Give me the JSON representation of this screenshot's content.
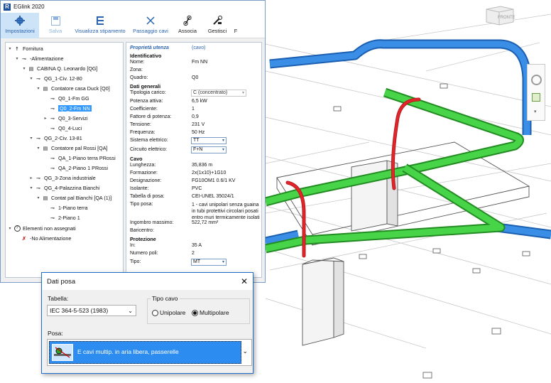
{
  "window": {
    "title": "EGlink 2020",
    "logo": "R"
  },
  "toolbar": [
    {
      "label": "Impostazioni",
      "icon": "gear-icon"
    },
    {
      "label": "Salva",
      "icon": "save-icon"
    },
    {
      "label": "Visualizza stipamento",
      "icon": "stipamento-icon"
    },
    {
      "label": "Passaggio cavi",
      "icon": "cross-icon"
    },
    {
      "label": "Associa",
      "icon": "link-icon"
    },
    {
      "label": "Gestisci",
      "icon": "tools-icon"
    },
    {
      "label": "F"
    }
  ],
  "tree": [
    {
      "label": "Fornitura"
    },
    {
      "label": "-Alimentazione"
    },
    {
      "label": "CABINA Q. Leonardo [QG]"
    },
    {
      "label": "QG_1-Civ. 12-80"
    },
    {
      "label": "Contatore casa Duck [Q0]"
    },
    {
      "label": "Q0_1-Fm GG"
    },
    {
      "label": "Q0_2-Fm NN"
    },
    {
      "label": "Q0_3-Servizi"
    },
    {
      "label": "Q0_4-Luci"
    },
    {
      "label": "QG_2-Civ. 13-81"
    },
    {
      "label": "Contatore pal Rossi [QA]"
    },
    {
      "label": "QA_1-Piano terra PRossi"
    },
    {
      "label": "QA_2-Piano 1  PRossi"
    },
    {
      "label": "QG_3-Zona industriale"
    },
    {
      "label": "QG_4-Palazzina Bianchi"
    },
    {
      "label": "Contat pal Bianchi [QA (1)]"
    },
    {
      "label": "1-Piano terra"
    },
    {
      "label": "2-Piano 1"
    },
    {
      "label": "Elementi non assegnati"
    },
    {
      "label": "-No Alimentazione"
    }
  ],
  "props": {
    "header": "Proprietà utenza",
    "header_type": "(cavo)",
    "sections": {
      "id": "Identificativo",
      "general": "Dati generali",
      "cable": "Cavo",
      "protection": "Protezione"
    },
    "rows": [
      {
        "k": "Nome:",
        "v": "Fm NN"
      },
      {
        "k": "Zona:",
        "v": ""
      },
      {
        "k": "Quadro:",
        "v": "Q0"
      },
      {
        "k": "Tipologia carico:",
        "v": "C (concentrato)"
      },
      {
        "k": "Potenza attiva:",
        "v": "6,5 kW"
      },
      {
        "k": "Coefficiente:",
        "v": "1"
      },
      {
        "k": "Fattore di potenza:",
        "v": "0,9"
      },
      {
        "k": "Tensione:",
        "v": "231 V"
      },
      {
        "k": "Frequenza:",
        "v": "50 Hz"
      },
      {
        "k": "Sistema elettrico:",
        "v": "TT"
      },
      {
        "k": "Circuito elettrico:",
        "v": "F+N"
      },
      {
        "k": "Lunghezza:",
        "v": "35,836 m"
      },
      {
        "k": "Formazione:",
        "v": "2x(1x10)+1G10"
      },
      {
        "k": "Designazione:",
        "v": "FG10OM1 0.6/1 KV"
      },
      {
        "k": "Isolante:",
        "v": "PVC"
      },
      {
        "k": "Tabella di posa:",
        "v": "CEI-UNEL 35024/1"
      },
      {
        "k": "Tipo posa:",
        "v": "1 - cavi unipolari senza guaina in tubi protettivi circolari posati entro muri termicamente isolati"
      },
      {
        "k": "Ingombro massimo:",
        "v": "522,72 mm²"
      },
      {
        "k": "Baricentro:",
        "v": ""
      },
      {
        "k": "In:",
        "v": "35 A"
      },
      {
        "k": "Numero poli:",
        "v": "2"
      },
      {
        "k": "Tipo:",
        "v": "MT"
      }
    ]
  },
  "dialog": {
    "title": "Dati posa",
    "tabella_label": "Tabella:",
    "tabella_value": "IEC 364-5-523 (1983)",
    "tipo_cavo_label": "Tipo cavo",
    "unipolare": "Unipolare",
    "multipolare": "Multipolare",
    "posa_label": "Posa:",
    "posa_value": "E cavi multip. in aria libera, passerelle"
  },
  "viewcube": {
    "label": "FRONTE"
  },
  "colors": {
    "tray_blue": "#2f7fd8",
    "tray_green": "#3ec83e",
    "cable_red": "#e0262a",
    "accent": "#2b64b0"
  }
}
